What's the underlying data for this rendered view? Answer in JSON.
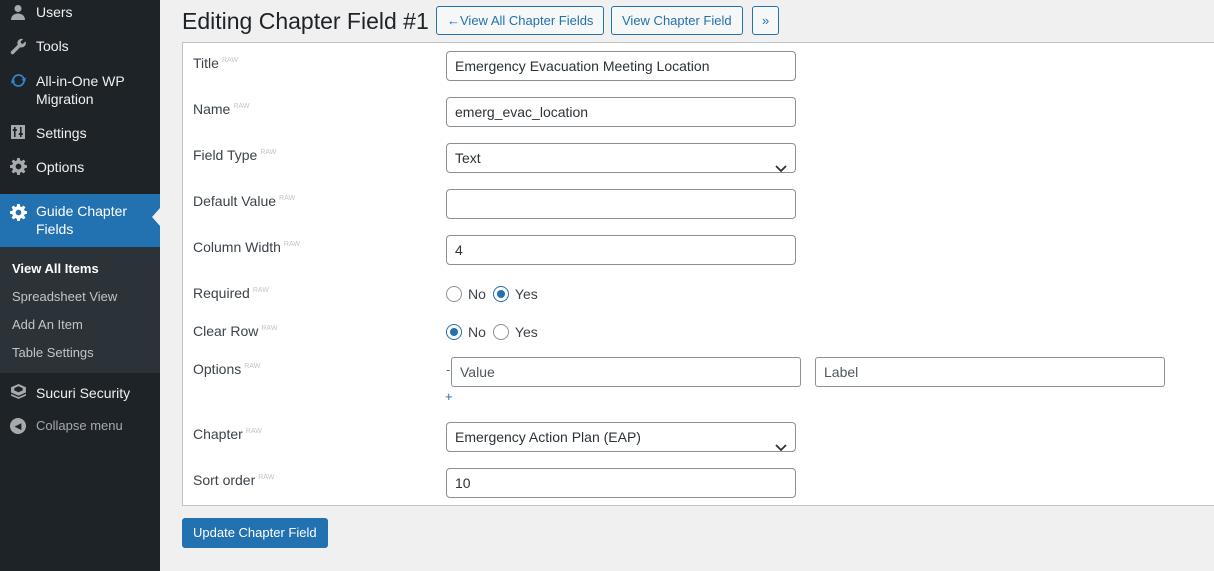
{
  "sidebar": {
    "items": [
      {
        "label": "Users",
        "icon": "users-icon"
      },
      {
        "label": "Tools",
        "icon": "wrench-icon"
      },
      {
        "label": "All-in-One WP Migration",
        "icon": "sync-icon"
      },
      {
        "label": "Settings",
        "icon": "sliders-icon"
      },
      {
        "label": "Options",
        "icon": "gear-icon"
      },
      {
        "label": "Guide Chapter Fields",
        "icon": "gear-icon"
      },
      {
        "label": "Sucuri Security",
        "icon": "shield-icon"
      },
      {
        "label": "Collapse menu",
        "icon": "collapse-icon"
      }
    ],
    "submenu": [
      "View All Items",
      "Spreadsheet View",
      "Add An Item",
      "Table Settings"
    ],
    "active_color": "#2271b1",
    "background": "#1d2327"
  },
  "header": {
    "title": "Editing Chapter Field #1",
    "buttons": [
      "←View All Chapter Fields",
      "View Chapter Field",
      "»"
    ]
  },
  "form": {
    "raw_tag": "RAW",
    "title": {
      "label": "Title",
      "value": "Emergency Evacuation Meeting Location"
    },
    "name": {
      "label": "Name",
      "value": "emerg_evac_location"
    },
    "field_type": {
      "label": "Field Type",
      "value": "Text"
    },
    "default_value": {
      "label": "Default Value",
      "value": ""
    },
    "column_width": {
      "label": "Column Width",
      "value": "4"
    },
    "required": {
      "label": "Required",
      "options": [
        "No",
        "Yes"
      ],
      "selected": "Yes"
    },
    "clear_row": {
      "label": "Clear Row",
      "options": [
        "No",
        "Yes"
      ],
      "selected": "No"
    },
    "options": {
      "label": "Options",
      "remove": "-",
      "add": "+",
      "value_placeholder": "Value",
      "label_placeholder": "Label"
    },
    "chapter": {
      "label": "Chapter",
      "value": "Emergency Action Plan (EAP)"
    },
    "sort_order": {
      "label": "Sort order",
      "value": "10"
    }
  },
  "submit_label": "Update Chapter Field"
}
